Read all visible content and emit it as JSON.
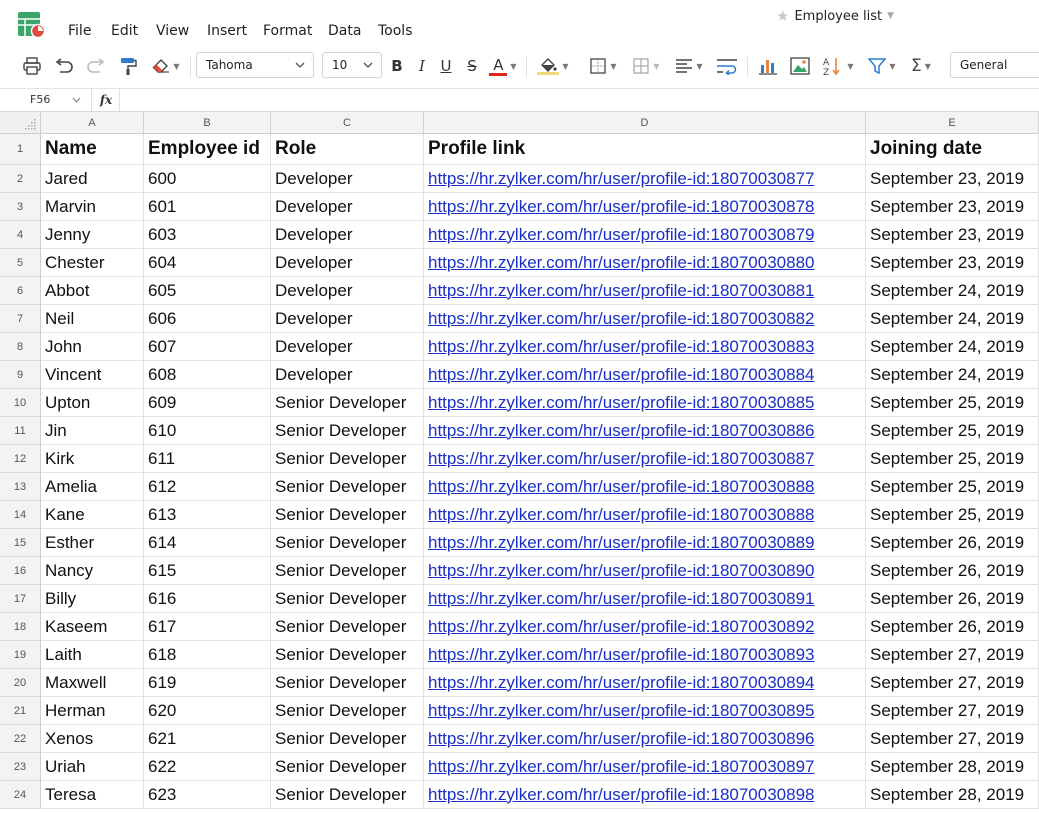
{
  "document": {
    "title": "Employee list"
  },
  "menu": [
    "File",
    "Edit",
    "View",
    "Insert",
    "Format",
    "Data",
    "Tools"
  ],
  "toolbar": {
    "font_name": "Tahoma",
    "font_size": "10",
    "bold": "B",
    "italic": "I",
    "underline": "U",
    "strike": "S",
    "font_color_letter": "A",
    "number_format": "General",
    "colors": {
      "font_color": "#e2231a",
      "fill_color": "#f2d677",
      "chart_blue": "#2d7dd2",
      "chart_orange": "#e8843a",
      "logo_green": "#39a56b",
      "logo_red": "#e14b3b"
    }
  },
  "formula_bar": {
    "cell_ref": "F56",
    "fx": "fx",
    "content": ""
  },
  "columns": [
    "A",
    "B",
    "C",
    "D",
    "E"
  ],
  "header_row": {
    "row": "1",
    "cells": [
      "Name",
      "Employee id",
      "Role",
      "Profile link",
      "Joining date"
    ]
  },
  "rows": [
    {
      "row": "2",
      "cells": [
        "Jared",
        "600",
        "Developer",
        "https://hr.zylker.com/hr/user/profile-id:18070030877",
        "September 23, 2019"
      ]
    },
    {
      "row": "3",
      "cells": [
        "Marvin",
        "601",
        "Developer",
        "https://hr.zylker.com/hr/user/profile-id:18070030878",
        "September 23, 2019"
      ]
    },
    {
      "row": "4",
      "cells": [
        "Jenny",
        "603",
        "Developer",
        "https://hr.zylker.com/hr/user/profile-id:18070030879",
        "September 23, 2019"
      ]
    },
    {
      "row": "5",
      "cells": [
        "Chester",
        "604",
        "Developer",
        "https://hr.zylker.com/hr/user/profile-id:18070030880",
        "September 23, 2019"
      ]
    },
    {
      "row": "6",
      "cells": [
        "Abbot",
        "605",
        "Developer",
        "https://hr.zylker.com/hr/user/profile-id:18070030881",
        "September 24, 2019"
      ]
    },
    {
      "row": "7",
      "cells": [
        "Neil",
        "606",
        "Developer",
        "https://hr.zylker.com/hr/user/profile-id:18070030882",
        "September 24, 2019"
      ]
    },
    {
      "row": "8",
      "cells": [
        "John",
        "607",
        "Developer",
        "https://hr.zylker.com/hr/user/profile-id:18070030883",
        "September 24, 2019"
      ]
    },
    {
      "row": "9",
      "cells": [
        "Vincent",
        "608",
        "Developer",
        "https://hr.zylker.com/hr/user/profile-id:18070030884",
        "September 24, 2019"
      ]
    },
    {
      "row": "10",
      "cells": [
        "Upton",
        "609",
        "Senior Developer",
        "https://hr.zylker.com/hr/user/profile-id:18070030885",
        "September 25, 2019"
      ]
    },
    {
      "row": "11",
      "cells": [
        "Jin",
        "610",
        "Senior Developer",
        "https://hr.zylker.com/hr/user/profile-id:18070030886",
        "September 25, 2019"
      ]
    },
    {
      "row": "12",
      "cells": [
        "Kirk",
        "611",
        "Senior Developer",
        "https://hr.zylker.com/hr/user/profile-id:18070030887",
        "September 25, 2019"
      ]
    },
    {
      "row": "13",
      "cells": [
        "Amelia",
        "612",
        "Senior Developer",
        "https://hr.zylker.com/hr/user/profile-id:18070030888",
        "September 25, 2019"
      ]
    },
    {
      "row": "14",
      "cells": [
        "Kane",
        "613",
        "Senior Developer",
        "https://hr.zylker.com/hr/user/profile-id:18070030888",
        "September 25, 2019"
      ]
    },
    {
      "row": "15",
      "cells": [
        "Esther",
        "614",
        "Senior Developer",
        "https://hr.zylker.com/hr/user/profile-id:18070030889",
        "September 26, 2019"
      ]
    },
    {
      "row": "16",
      "cells": [
        "Nancy",
        "615",
        "Senior Developer",
        "https://hr.zylker.com/hr/user/profile-id:18070030890",
        "September 26, 2019"
      ]
    },
    {
      "row": "17",
      "cells": [
        "Billy",
        "616",
        "Senior Developer",
        "https://hr.zylker.com/hr/user/profile-id:18070030891",
        "September 26, 2019"
      ]
    },
    {
      "row": "18",
      "cells": [
        "Kaseem",
        "617",
        "Senior Developer",
        "https://hr.zylker.com/hr/user/profile-id:18070030892",
        "September 26, 2019"
      ]
    },
    {
      "row": "19",
      "cells": [
        "Laith",
        "618",
        "Senior Developer",
        "https://hr.zylker.com/hr/user/profile-id:18070030893",
        "September 27, 2019"
      ]
    },
    {
      "row": "20",
      "cells": [
        "Maxwell",
        "619",
        "Senior Developer",
        "https://hr.zylker.com/hr/user/profile-id:18070030894",
        "September 27, 2019"
      ]
    },
    {
      "row": "21",
      "cells": [
        "Herman",
        "620",
        "Senior Developer",
        "https://hr.zylker.com/hr/user/profile-id:18070030895",
        "September 27, 2019"
      ]
    },
    {
      "row": "22",
      "cells": [
        "Xenos",
        "621",
        "Senior Developer",
        "https://hr.zylker.com/hr/user/profile-id:18070030896",
        "September 27, 2019"
      ]
    },
    {
      "row": "23",
      "cells": [
        "Uriah",
        "622",
        "Senior Developer",
        "https://hr.zylker.com/hr/user/profile-id:18070030897",
        "September 28, 2019"
      ]
    },
    {
      "row": "24",
      "cells": [
        "Teresa",
        "623",
        "Senior Developer",
        "https://hr.zylker.com/hr/user/profile-id:18070030898",
        "September 28, 2019"
      ]
    }
  ]
}
